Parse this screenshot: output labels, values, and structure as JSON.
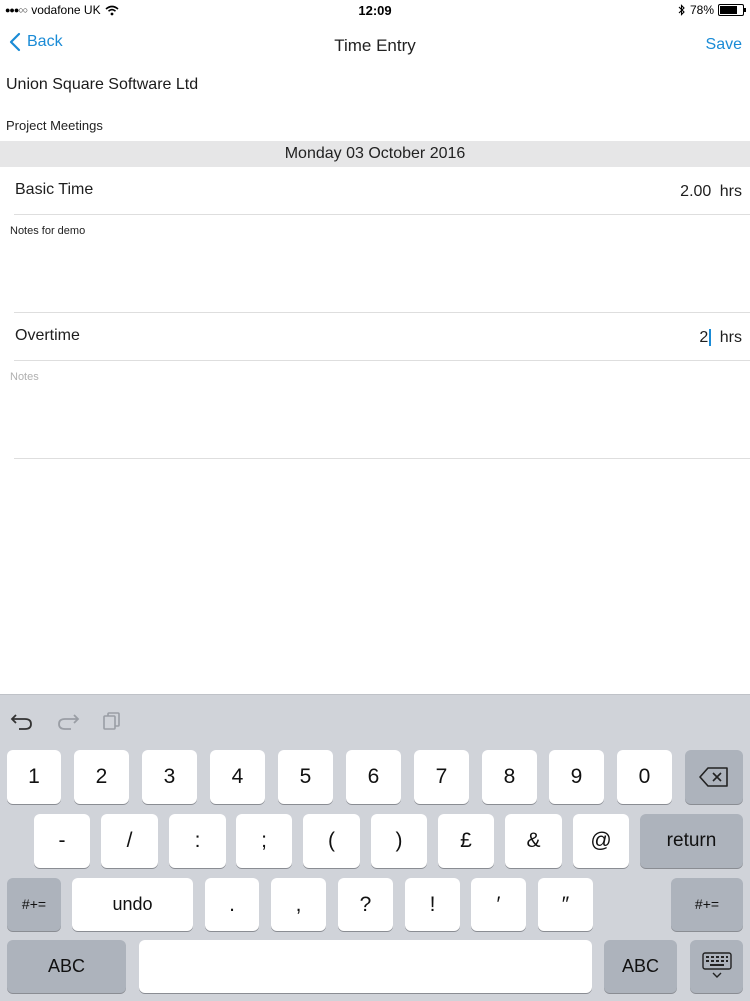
{
  "status": {
    "carrier": "vodafone UK",
    "time": "12:09",
    "battery": "78%",
    "battery_level": 0.78
  },
  "nav": {
    "back_label": "Back",
    "title": "Time Entry",
    "save_label": "Save"
  },
  "entry": {
    "company": "Union Square Software Ltd",
    "project": "Project Meetings",
    "date": "Monday 03 October 2016",
    "basic_label": "Basic Time",
    "basic_value": "2.00",
    "basic_unit": "hrs",
    "basic_note": "Notes for demo",
    "overtime_label": "Overtime",
    "overtime_value": "2",
    "overtime_unit": "hrs",
    "overtime_note_placeholder": "Notes"
  },
  "keyboard": {
    "row1": [
      "1",
      "2",
      "3",
      "4",
      "5",
      "6",
      "7",
      "8",
      "9",
      "0"
    ],
    "row2": [
      "-",
      "/",
      ":",
      ";",
      "(",
      ")",
      "£",
      "&",
      "@"
    ],
    "return_label": "return",
    "row3_left": "#+=",
    "undo_label": "undo",
    "row3": [
      ".",
      ",",
      "?",
      "!",
      "′",
      "″"
    ],
    "row3_right": "#+=",
    "abc_left": "ABC",
    "abc_right": "ABC"
  },
  "icons": [
    "signal-dots-icon",
    "wifi-icon",
    "bluetooth-icon",
    "battery-icon",
    "chevron-left-icon",
    "undo-icon",
    "redo-icon",
    "paste-icon",
    "backspace-icon",
    "keyboard-dismiss-icon"
  ]
}
